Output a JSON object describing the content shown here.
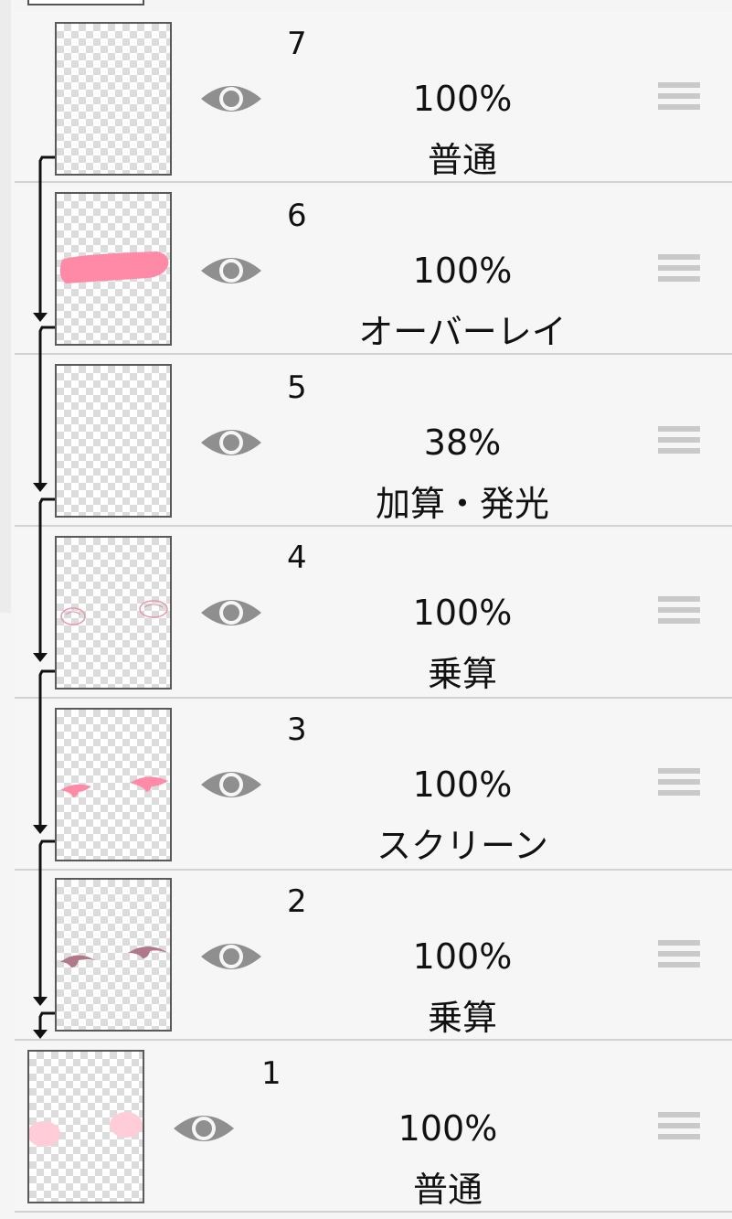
{
  "layers": [
    {
      "number": "7",
      "opacity": "100%",
      "mode": "普通"
    },
    {
      "number": "6",
      "opacity": "100%",
      "mode": "オーバーレイ"
    },
    {
      "number": "5",
      "opacity": "38%",
      "mode": "加算・発光"
    },
    {
      "number": "4",
      "opacity": "100%",
      "mode": "乗算"
    },
    {
      "number": "3",
      "opacity": "100%",
      "mode": "スクリーン"
    },
    {
      "number": "2",
      "opacity": "100%",
      "mode": "乗算"
    },
    {
      "number": "1",
      "opacity": "100%",
      "mode": "普通"
    }
  ],
  "icons": {
    "visibility": "eye-icon",
    "reorder": "drag-handle-icon",
    "clip": "clipping-arrow-icon"
  },
  "colors": {
    "pink": "#ff8aa8",
    "eye_gray": "#8f8f8f",
    "line": "#111111"
  }
}
